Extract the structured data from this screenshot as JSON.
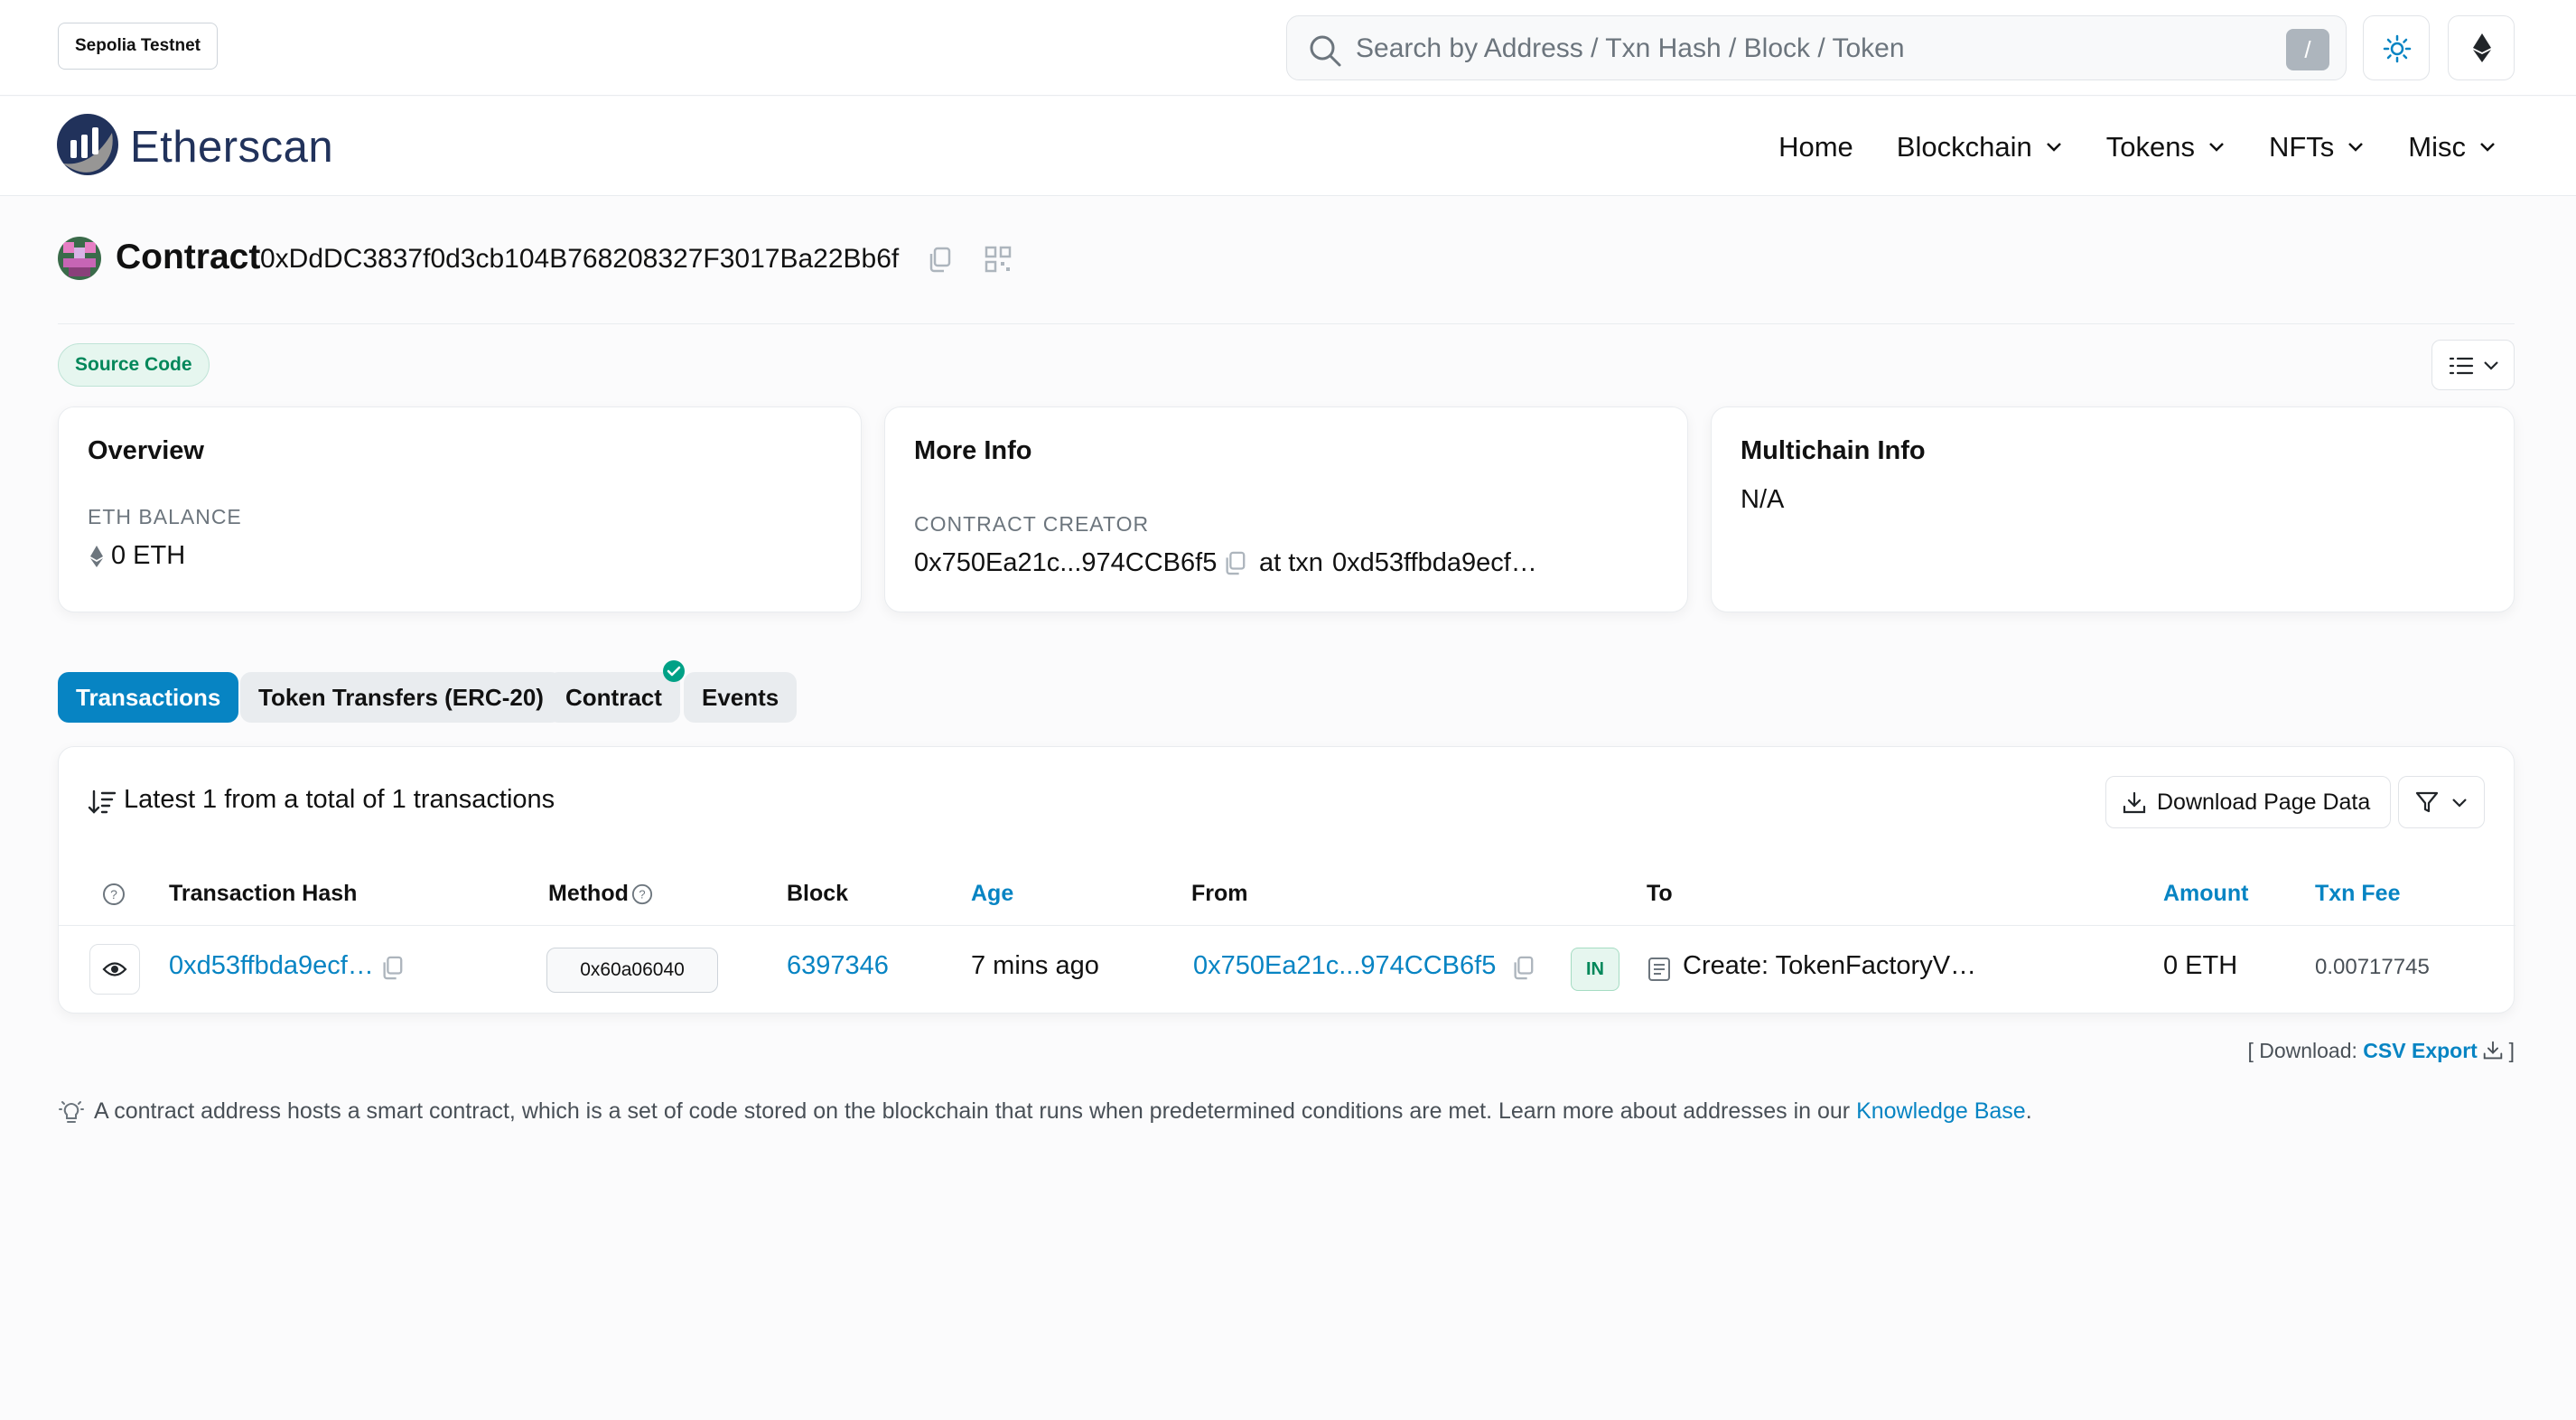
{
  "topbar": {
    "network": "Sepolia Testnet",
    "search_placeholder": "Search by Address / Txn Hash / Block / Token",
    "search_shortcut": "/"
  },
  "brand": {
    "name": "Etherscan"
  },
  "nav": {
    "items": [
      {
        "label": "Home",
        "dropdown": false
      },
      {
        "label": "Blockchain",
        "dropdown": true
      },
      {
        "label": "Tokens",
        "dropdown": true
      },
      {
        "label": "NFTs",
        "dropdown": true
      },
      {
        "label": "Misc",
        "dropdown": true
      }
    ]
  },
  "contract": {
    "label": "Contract",
    "address": "0xDdDC3837f0d3cb104B768208327F3017Ba22Bb6f",
    "source_badge": "Source Code"
  },
  "overview": {
    "title": "Overview",
    "balance_label": "ETH BALANCE",
    "balance_value": "0 ETH"
  },
  "more_info": {
    "title": "More Info",
    "creator_label": "CONTRACT CREATOR",
    "creator_address": "0x750Ea21c...974CCB6f5",
    "at_txn_text": "at txn",
    "creator_txn": "0xd53ffbda9ecf…"
  },
  "multichain": {
    "title": "Multichain Info",
    "value": "N/A"
  },
  "tabs": [
    {
      "label": "Transactions",
      "active": true
    },
    {
      "label": "Token Transfers (ERC-20)",
      "active": false
    },
    {
      "label": "Contract",
      "active": false,
      "verified": true
    },
    {
      "label": "Events",
      "active": false
    }
  ],
  "transactions": {
    "summary": "Latest 1 from a total of 1 transactions",
    "download_label": "Download Page Data",
    "headers": {
      "hash": "Transaction Hash",
      "method": "Method",
      "block": "Block",
      "age": "Age",
      "from": "From",
      "to": "To",
      "amount": "Amount",
      "fee": "Txn Fee"
    },
    "rows": [
      {
        "hash": "0xd53ffbda9ecf…",
        "method": "0x60a06040",
        "block": "6397346",
        "age": "7 mins ago",
        "from": "0x750Ea21c...974CCB6f5",
        "direction": "IN",
        "to": "Create: TokenFactoryV…",
        "amount": "0 ETH",
        "fee": "0.00717745"
      }
    ]
  },
  "csv": {
    "prefix": "[ Download:",
    "link": "CSV Export",
    "suffix": "]"
  },
  "note": {
    "text": "A contract address hosts a smart contract, which is a set of code stored on the blockchain that runs when predetermined conditions are met. Learn more about addresses in our",
    "link": "Knowledge Base",
    "end": "."
  },
  "colors": {
    "accent": "#0784c3",
    "success": "#00875a",
    "brand_navy": "#21325b"
  }
}
